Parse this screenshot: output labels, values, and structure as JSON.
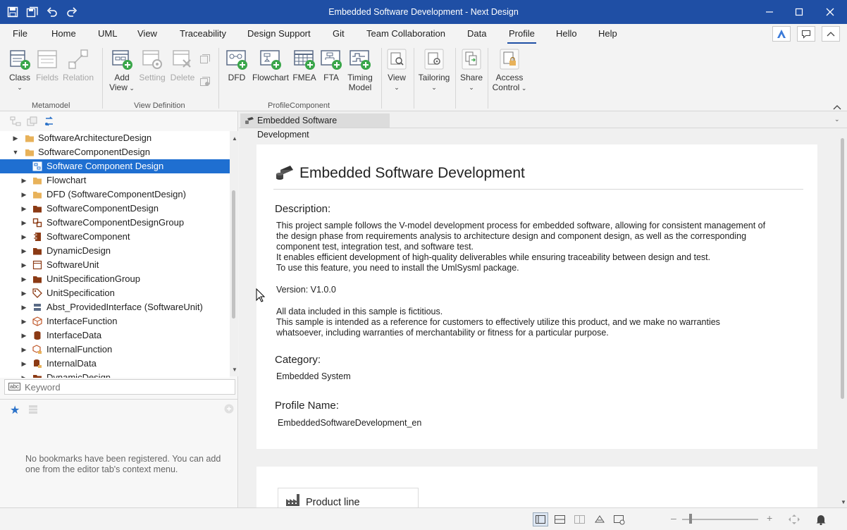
{
  "window": {
    "title": "Embedded Software Development - Next Design"
  },
  "menu": {
    "items": [
      "File",
      "Home",
      "UML",
      "View",
      "Traceability",
      "Design Support",
      "Git",
      "Team Collaboration",
      "Data",
      "Profile",
      "Hello",
      "Help"
    ],
    "active": "Profile"
  },
  "ribbon": {
    "metamodel": {
      "label": "Metamodel",
      "class_label": "Class",
      "fields_label": "Fields",
      "relation_label": "Relation"
    },
    "view_definition": {
      "label": "View Definition",
      "add_view_line1": "Add",
      "add_view_line2": "View",
      "setting_label": "Setting",
      "delete_label": "Delete"
    },
    "profile_component": {
      "label": "ProfileComponent",
      "dfd_label": "DFD",
      "flowchart_label": "Flowchart",
      "fmea_label": "FMEA",
      "fta_label": "FTA",
      "timing_line1": "Timing",
      "timing_line2": "Model"
    },
    "other": {
      "view_label": "View",
      "tailoring_label": "Tailoring",
      "share_label": "Share",
      "access_line1": "Access",
      "access_line2": "Control"
    }
  },
  "tree": {
    "items": [
      {
        "label": "SoftwareArchitectureDesign",
        "icon": "folder-icon",
        "expanded": false
      },
      {
        "label": "SoftwareComponentDesign",
        "icon": "folder-icon",
        "expanded": true
      },
      {
        "label": "Software Component Design",
        "icon": "diagram-icon",
        "selected": true
      },
      {
        "label": "Flowchart",
        "icon": "folder-icon"
      },
      {
        "label": "DFD (SoftwareComponentDesign)",
        "icon": "folder-icon"
      },
      {
        "label": "SoftwareComponentDesign",
        "icon": "package-icon"
      },
      {
        "label": "SoftwareComponentDesignGroup",
        "icon": "group-icon"
      },
      {
        "label": "SoftwareComponent",
        "icon": "component-icon"
      },
      {
        "label": "DynamicDesign",
        "icon": "package-icon"
      },
      {
        "label": "SoftwareUnit",
        "icon": "unit-icon"
      },
      {
        "label": "UnitSpecificationGroup",
        "icon": "package-icon"
      },
      {
        "label": "UnitSpecification",
        "icon": "tag-icon"
      },
      {
        "label": "Abst_ProvidedInterface (SoftwareUnit)",
        "icon": "interface-icon"
      },
      {
        "label": "InterfaceFunction",
        "icon": "cube-icon"
      },
      {
        "label": "InterfaceData",
        "icon": "cylinder-icon"
      },
      {
        "label": "InternalFunction",
        "icon": "cube-lock-icon"
      },
      {
        "label": "InternalData",
        "icon": "cylinder-lock-icon"
      },
      {
        "label": "DynamicDesign",
        "icon": "package-icon"
      }
    ]
  },
  "search": {
    "placeholder": "Keyword"
  },
  "bookmarks": {
    "empty_message": "No bookmarks have been registered. You can add one from the editor tab's context menu."
  },
  "editor": {
    "tab_label": "Embedded Software Development",
    "project_title": "Embedded Software Development",
    "description_heading": "Description:",
    "description_lines": [
      "This project sample follows the V-model development process for embedded software, allowing for consistent management of",
      "the design phase from requirements analysis to architecture design and component design, as well as the corresponding",
      "component test, integration test, and software test.",
      "It enables efficient development of high-quality deliverables while ensuring traceability between design and test.",
      "To use this feature, you need to install the UmlSysml package.",
      "",
      "Version: V1.0.0",
      "",
      "All data included in this sample is fictitious.",
      "This sample is intended as a reference for customers to effectively utilize this product, and we make no warranties",
      "whatsoever, including warranties of merchantability or fitness for a particular purpose."
    ],
    "category_heading": "Category:",
    "category_value": "Embedded System",
    "profile_name_heading": "Profile Name:",
    "profile_name_value": "EmbeddedSoftwareDevelopment_en",
    "product_line_label": "Product line"
  },
  "colors": {
    "titlebar": "#1f4fa5",
    "selection": "#1f6fd1",
    "accent_green": "#3aa64a",
    "folder": "#e8b25a"
  }
}
